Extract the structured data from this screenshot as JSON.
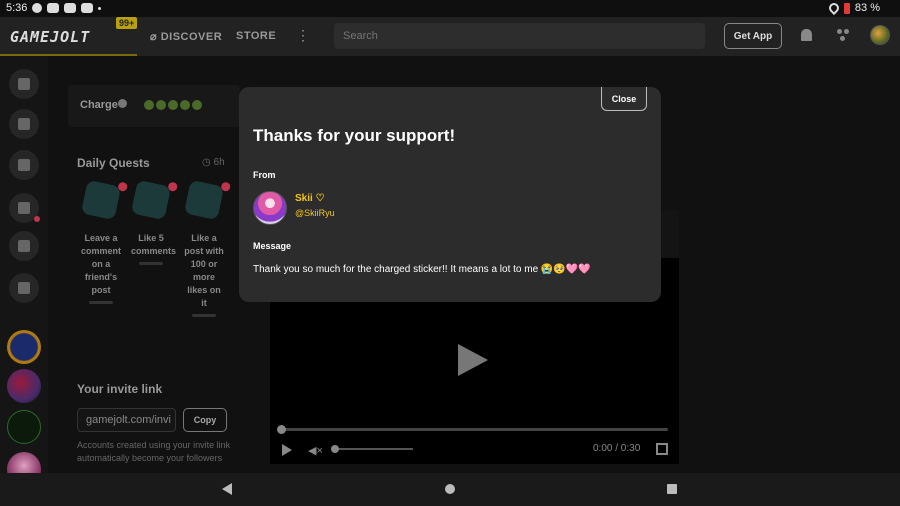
{
  "status_bar": {
    "time": "5:36",
    "battery": "83 %",
    "battery_color": "#e53935"
  },
  "nav": {
    "logo": "GAMEJOLT",
    "notifications_badge": "99+",
    "discover": "DISCOVER",
    "store": "STORE",
    "more": "⋮",
    "search_placeholder": "Search",
    "get_app": "Get App",
    "icons": [
      "bell-icon",
      "friends-icon",
      "user-avatar"
    ]
  },
  "sidebar": {
    "items": [
      "home-icon",
      "store-icon",
      "backpack-icon",
      "quests-icon",
      "chat-icon",
      "ranks-icon"
    ],
    "communities": [
      "community-1",
      "community-2",
      "community-3",
      "community-4"
    ]
  },
  "charge": {
    "label": "Charge",
    "orbs": 5
  },
  "daily_quests": {
    "title": "Daily Quests",
    "time_left": "6h",
    "quests": [
      {
        "text": "Leave a comment on a friend's post"
      },
      {
        "text": "Like 5 comments"
      },
      {
        "text": "Like a post with 100 or more likes on it"
      }
    ]
  },
  "invite": {
    "title": "Your invite link",
    "link": "gamejolt.com/invi",
    "copy": "Copy",
    "description": "Accounts created using your invite link automatically become your followers"
  },
  "video": {
    "time": "0:00 / 0:30"
  },
  "modal": {
    "close": "Close",
    "title": "Thanks for your support!",
    "from_label": "From",
    "sender_name": "Skii ♡",
    "sender_handle": "@SkiiRyu",
    "message_label": "Message",
    "message": "Thank you so much for the charged sticker!! It means a lot to me 😭🥺🩷🩷",
    "accent_color": "#f5c518"
  }
}
